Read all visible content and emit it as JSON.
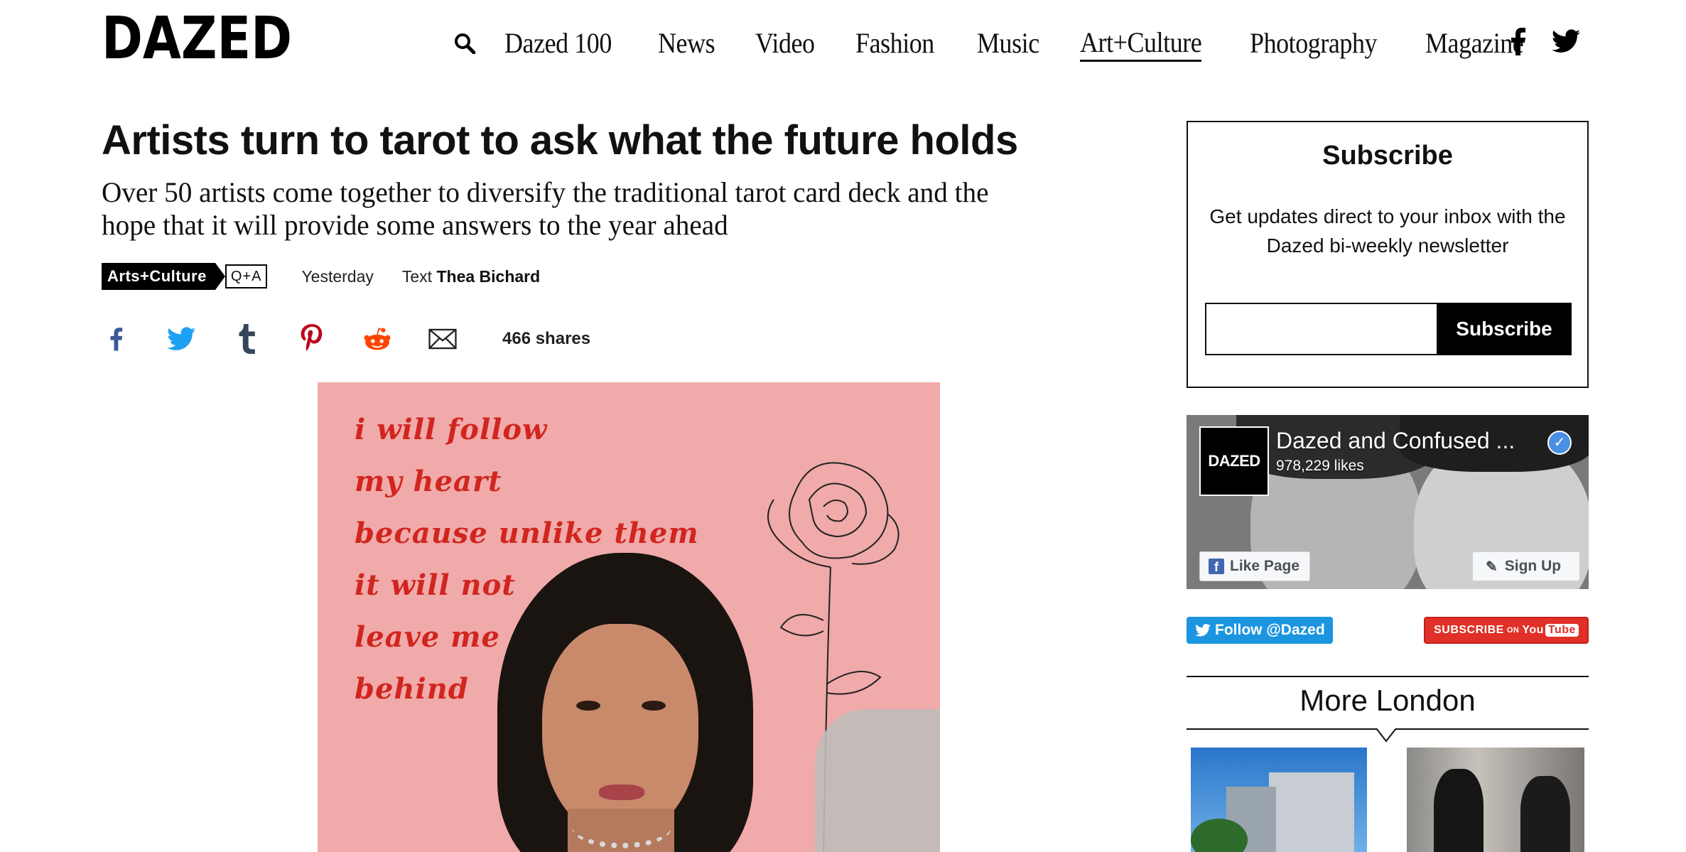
{
  "header": {
    "logo": "DAZED",
    "nav": [
      {
        "label": "Dazed 100",
        "active": false
      },
      {
        "label": "News",
        "active": false
      },
      {
        "label": "Video",
        "active": false
      },
      {
        "label": "Fashion",
        "active": false
      },
      {
        "label": "Music",
        "active": false
      },
      {
        "label": "Art+Culture",
        "active": true
      },
      {
        "label": "Photography",
        "active": false
      },
      {
        "label": "Magazine",
        "active": false
      }
    ],
    "icons": [
      "search-icon",
      "facebook-icon",
      "twitter-icon"
    ]
  },
  "article": {
    "title": "Artists turn to tarot to ask what the future holds",
    "subtitle": "Over 50 artists come together to diversify the traditional tarot card deck and the hope that it will provide some answers to the year ahead",
    "tag_primary": "Arts+Culture",
    "tag_secondary": "Q+A",
    "date": "Yesterday",
    "byline_prefix": "Text",
    "author": "Thea Bichard",
    "share_count": "466 shares",
    "share_icons": [
      "facebook-icon",
      "twitter-icon",
      "tumblr-icon",
      "pinterest-icon",
      "reddit-icon",
      "email-icon"
    ],
    "hero_poem": [
      "i will follow",
      "my heart",
      "because unlike them",
      "it will not",
      "leave me",
      "behind"
    ]
  },
  "sidebar": {
    "subscribe": {
      "title": "Subscribe",
      "description": "Get updates direct to your inbox with the Dazed bi-weekly newsletter",
      "input_value": "",
      "button": "Subscribe"
    },
    "facebook": {
      "logo": "DAZED",
      "page_name": "Dazed and Confused ...",
      "likes": "978,229 likes",
      "like_button": "Like Page",
      "signup_button": "Sign Up"
    },
    "twitter_follow": "Follow @Dazed",
    "youtube": {
      "subscribe": "SUBSCRIBE",
      "on": "ON",
      "you": "You",
      "tube": "Tube"
    },
    "more_title": "More London"
  },
  "colors": {
    "accent_text": "#111111",
    "hero_background": "#f0aaa9",
    "poem_red": "#d1251f",
    "facebook_blue": "#3b5998",
    "twitter_blue": "#1da1f2",
    "tumblr_navy": "#35465c",
    "pinterest_red": "#bd081c",
    "reddit_orange": "#ff4500",
    "youtube_red": "#e03027"
  }
}
